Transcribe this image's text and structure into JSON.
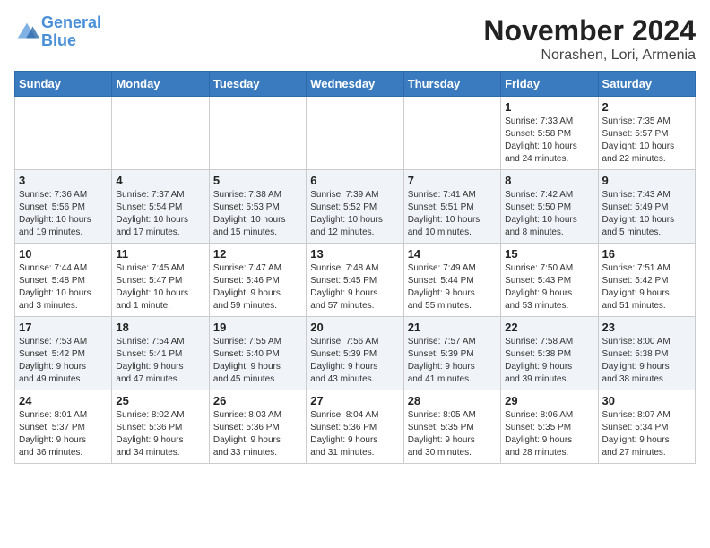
{
  "header": {
    "logo_line1": "General",
    "logo_line2": "Blue",
    "month": "November 2024",
    "location": "Norashen, Lori, Armenia"
  },
  "weekdays": [
    "Sunday",
    "Monday",
    "Tuesday",
    "Wednesday",
    "Thursday",
    "Friday",
    "Saturday"
  ],
  "weeks": [
    [
      {
        "day": "",
        "info": ""
      },
      {
        "day": "",
        "info": ""
      },
      {
        "day": "",
        "info": ""
      },
      {
        "day": "",
        "info": ""
      },
      {
        "day": "",
        "info": ""
      },
      {
        "day": "1",
        "info": "Sunrise: 7:33 AM\nSunset: 5:58 PM\nDaylight: 10 hours\nand 24 minutes."
      },
      {
        "day": "2",
        "info": "Sunrise: 7:35 AM\nSunset: 5:57 PM\nDaylight: 10 hours\nand 22 minutes."
      }
    ],
    [
      {
        "day": "3",
        "info": "Sunrise: 7:36 AM\nSunset: 5:56 PM\nDaylight: 10 hours\nand 19 minutes."
      },
      {
        "day": "4",
        "info": "Sunrise: 7:37 AM\nSunset: 5:54 PM\nDaylight: 10 hours\nand 17 minutes."
      },
      {
        "day": "5",
        "info": "Sunrise: 7:38 AM\nSunset: 5:53 PM\nDaylight: 10 hours\nand 15 minutes."
      },
      {
        "day": "6",
        "info": "Sunrise: 7:39 AM\nSunset: 5:52 PM\nDaylight: 10 hours\nand 12 minutes."
      },
      {
        "day": "7",
        "info": "Sunrise: 7:41 AM\nSunset: 5:51 PM\nDaylight: 10 hours\nand 10 minutes."
      },
      {
        "day": "8",
        "info": "Sunrise: 7:42 AM\nSunset: 5:50 PM\nDaylight: 10 hours\nand 8 minutes."
      },
      {
        "day": "9",
        "info": "Sunrise: 7:43 AM\nSunset: 5:49 PM\nDaylight: 10 hours\nand 5 minutes."
      }
    ],
    [
      {
        "day": "10",
        "info": "Sunrise: 7:44 AM\nSunset: 5:48 PM\nDaylight: 10 hours\nand 3 minutes."
      },
      {
        "day": "11",
        "info": "Sunrise: 7:45 AM\nSunset: 5:47 PM\nDaylight: 10 hours\nand 1 minute."
      },
      {
        "day": "12",
        "info": "Sunrise: 7:47 AM\nSunset: 5:46 PM\nDaylight: 9 hours\nand 59 minutes."
      },
      {
        "day": "13",
        "info": "Sunrise: 7:48 AM\nSunset: 5:45 PM\nDaylight: 9 hours\nand 57 minutes."
      },
      {
        "day": "14",
        "info": "Sunrise: 7:49 AM\nSunset: 5:44 PM\nDaylight: 9 hours\nand 55 minutes."
      },
      {
        "day": "15",
        "info": "Sunrise: 7:50 AM\nSunset: 5:43 PM\nDaylight: 9 hours\nand 53 minutes."
      },
      {
        "day": "16",
        "info": "Sunrise: 7:51 AM\nSunset: 5:42 PM\nDaylight: 9 hours\nand 51 minutes."
      }
    ],
    [
      {
        "day": "17",
        "info": "Sunrise: 7:53 AM\nSunset: 5:42 PM\nDaylight: 9 hours\nand 49 minutes."
      },
      {
        "day": "18",
        "info": "Sunrise: 7:54 AM\nSunset: 5:41 PM\nDaylight: 9 hours\nand 47 minutes."
      },
      {
        "day": "19",
        "info": "Sunrise: 7:55 AM\nSunset: 5:40 PM\nDaylight: 9 hours\nand 45 minutes."
      },
      {
        "day": "20",
        "info": "Sunrise: 7:56 AM\nSunset: 5:39 PM\nDaylight: 9 hours\nand 43 minutes."
      },
      {
        "day": "21",
        "info": "Sunrise: 7:57 AM\nSunset: 5:39 PM\nDaylight: 9 hours\nand 41 minutes."
      },
      {
        "day": "22",
        "info": "Sunrise: 7:58 AM\nSunset: 5:38 PM\nDaylight: 9 hours\nand 39 minutes."
      },
      {
        "day": "23",
        "info": "Sunrise: 8:00 AM\nSunset: 5:38 PM\nDaylight: 9 hours\nand 38 minutes."
      }
    ],
    [
      {
        "day": "24",
        "info": "Sunrise: 8:01 AM\nSunset: 5:37 PM\nDaylight: 9 hours\nand 36 minutes."
      },
      {
        "day": "25",
        "info": "Sunrise: 8:02 AM\nSunset: 5:36 PM\nDaylight: 9 hours\nand 34 minutes."
      },
      {
        "day": "26",
        "info": "Sunrise: 8:03 AM\nSunset: 5:36 PM\nDaylight: 9 hours\nand 33 minutes."
      },
      {
        "day": "27",
        "info": "Sunrise: 8:04 AM\nSunset: 5:36 PM\nDaylight: 9 hours\nand 31 minutes."
      },
      {
        "day": "28",
        "info": "Sunrise: 8:05 AM\nSunset: 5:35 PM\nDaylight: 9 hours\nand 30 minutes."
      },
      {
        "day": "29",
        "info": "Sunrise: 8:06 AM\nSunset: 5:35 PM\nDaylight: 9 hours\nand 28 minutes."
      },
      {
        "day": "30",
        "info": "Sunrise: 8:07 AM\nSunset: 5:34 PM\nDaylight: 9 hours\nand 27 minutes."
      }
    ]
  ]
}
